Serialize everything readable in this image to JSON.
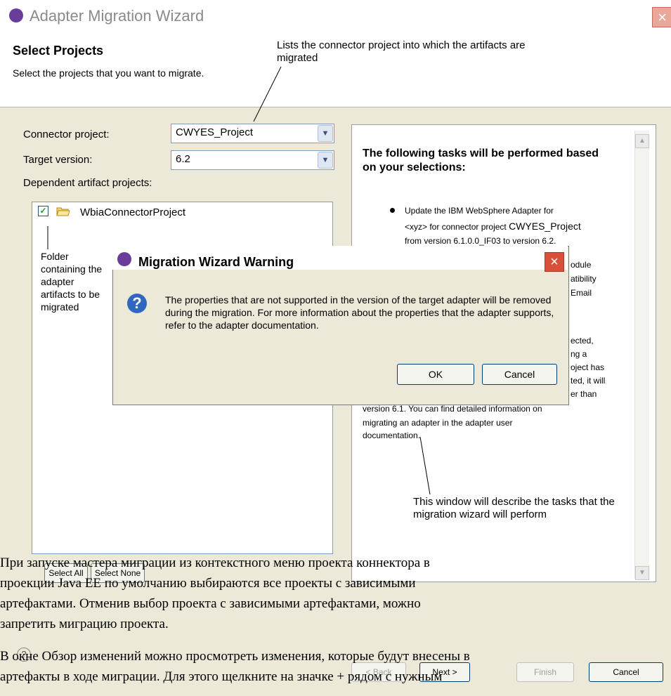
{
  "window": {
    "title": "Adapter Migration Wizard",
    "close": "×"
  },
  "header": {
    "title": "Select Projects",
    "description": "Select the projects that you want to migrate."
  },
  "annotations": {
    "connector": "Lists the connector project into which the artifacts are migrated",
    "folder": "Folder containing the adapter artifacts to be migrated",
    "tasks": "This window will describe the tasks that the migration wizard will perform"
  },
  "form": {
    "connector_label": "Connector project:",
    "connector_value": "CWYES_Project",
    "target_label": "Target version:",
    "target_value": "6.2",
    "dependent_label": "Dependent artifact projects:",
    "tree_item": "WbiaConnectorProject",
    "checkbox_mark": "✓",
    "combo_arrow": "▼"
  },
  "task_panel": {
    "heading": "The following tasks will be performed based on your selections:",
    "bullet_line1": "Update the IBM WebSphere Adapter for",
    "bullet_line2a": "<xyz> for connector project ",
    "bullet_line2b": "CWYES_Project",
    "bullet_line3": "from version 6.1.0.0_IF03 to version 6.2.",
    "fragments": [
      "odule",
      "atibility",
      "Email",
      "ected,",
      "ng a",
      "oject has",
      "ted, it will",
      "er than"
    ],
    "para_line1": "version 6.1. You can find detailed information on",
    "para_line2": "migrating an adapter in the adapter user",
    "para_line3": "documentation."
  },
  "dialog": {
    "title": "Migration Wizard Warning",
    "close": "×",
    "icon": "?",
    "message": "The properties that are not supported in the version of the target adapter will be removed during the migration. For more information about the properties that the adapter supports, refer to the adapter documentation.",
    "ok": "OK",
    "cancel": "Cancel"
  },
  "buttons": {
    "select_all": "Select All",
    "select_none": "Select None",
    "help": "?",
    "back": "< Back",
    "next": "Next >",
    "finish": "Finish",
    "cancel": "Cancel"
  },
  "overlay_text": {
    "line1": "При запуске мастера миграции из контекстного меню проекта коннектора в",
    "line2": "проекции Java EE по умолчанию выбираются все проекты с зависимыми",
    "line3": "артефактами. Отменив выбор проекта с зависимыми артефактами, можно",
    "line4": "запретить миграцию проекта.",
    "line5": "В окне Обзор изменений можно просмотреть изменения, которые будут внесены в",
    "line6": "артефакты в ходе миграции. Для этого щелкните на значке + рядом с нужным"
  }
}
